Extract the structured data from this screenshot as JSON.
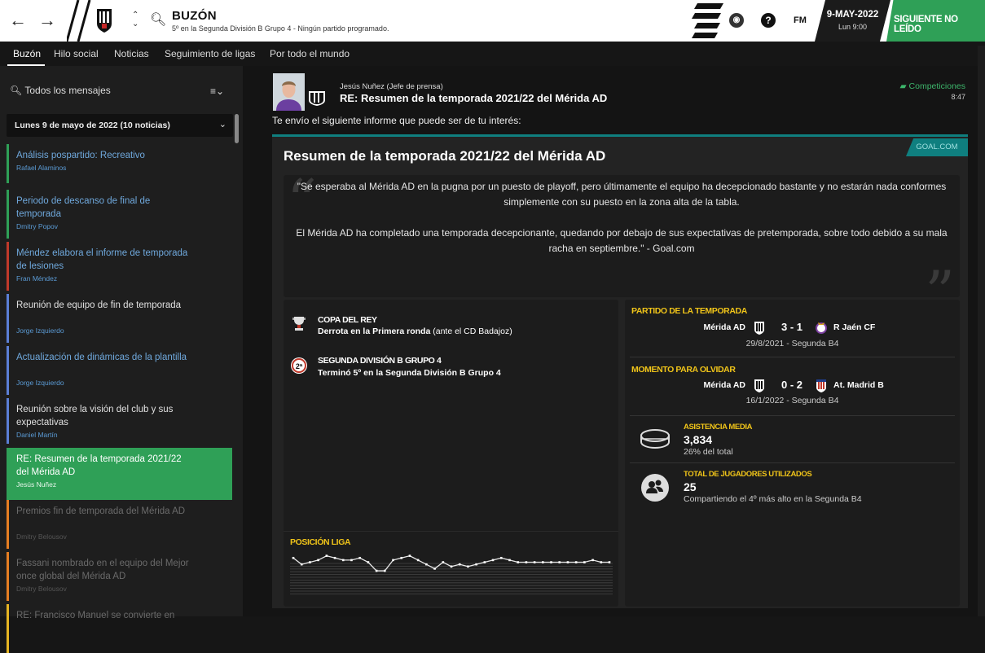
{
  "topbar": {
    "back_icon": "arrow-left-icon",
    "forward_icon": "arrow-right-icon",
    "title": "BUZÓN",
    "subtitle": "5º en la Segunda División B Grupo 4 - Ningún partido programado.",
    "fm_label": "FM",
    "help_label": "?",
    "date": "9-MAY-2022",
    "day": "Lun 9:00",
    "next_button": "SIGUIENTE NO LEÍDO",
    "colors": {
      "accent": "#2fa057",
      "teal": "#0f7f7f",
      "yellow": "#f0c419"
    }
  },
  "tabs": [
    "Buzón",
    "Hilo social",
    "Noticias",
    "Seguimiento de ligas",
    "Por todo el mundo"
  ],
  "sidebar": {
    "filter": "Todos los mensajes",
    "day_header": "Lunes 9 de mayo de 2022 (10 noticias)",
    "messages": [
      {
        "title": "Análisis pospartido: Recreativo",
        "sender": "Rafael Alaminos",
        "color": "#2fa057",
        "text_color": "#6fa8dc"
      },
      {
        "title": "Periodo de descanso de final de temporada",
        "sender": "Dmitry Popov",
        "color": "#2fa057",
        "text_color": "#6fa8dc"
      },
      {
        "title": "Méndez elabora el informe de temporada de lesiones",
        "sender": "Fran Méndez",
        "color": "#c0392b",
        "text_color": "#6fa8dc"
      },
      {
        "title": "Reunión de equipo de fin de temporada",
        "sender": "Jorge Izquierdo",
        "color": "#5b7fd6",
        "text_color": "#e0e0e0"
      },
      {
        "title": "Actualización de dinámicas de la plantilla",
        "sender": "Jorge Izquierdo",
        "color": "#5b7fd6",
        "text_color": "#6fa8dc"
      },
      {
        "title": "Reunión sobre la visión del club y sus expectativas",
        "sender": "Daniel Martín",
        "color": "#5b7fd6",
        "text_color": "#e0e0e0"
      },
      {
        "title": "RE: Resumen de la temporada 2021/22 del Mérida AD",
        "sender": "Jesús Nuñez",
        "color": "#2fa057",
        "text_color": "#ffffff"
      },
      {
        "title": "Premios fin de temporada del Mérida AD",
        "sender": "Dmitry Belousov",
        "color": "#e67e22",
        "text_color": "#6a6a6a"
      },
      {
        "title": "Fassani nombrado en el equipo del Mejor once global del Mérida AD",
        "sender": "Dmitry Belousov",
        "color": "#e67e22",
        "text_color": "#6a6a6a"
      },
      {
        "title": "RE: Francisco Manuel se convierte en",
        "sender": "",
        "color": "#e6b422",
        "text_color": "#6a6a6a"
      }
    ]
  },
  "message": {
    "sender": "Jesús Nuñez  (Jefe de prensa)",
    "subject": "RE: Resumen de la temporada 2021/22 del Mérida AD",
    "category": "Competiciones",
    "time": "8:47",
    "intro": "Te envío el siguiente informe que puede ser de tu interés:",
    "source": "GOAL.COM",
    "article_title": "Resumen de la temporada 2021/22 del Mérida AD",
    "quote_p1": "\"Se esperaba al Mérida AD en la pugna por un puesto de playoff, pero últimamente el equipo ha decepcionado bastante y no estarán nada conformes simplemente con su puesto en la zona alta de la tabla.",
    "quote_p2": "El Mérida AD ha completado una temporada decepcionante, quedando por debajo de sus expectativas de pretemporada, sobre todo debido a su mala racha en septiembre.\" - Goal.com"
  },
  "competitions": [
    {
      "name": "COPA DEL REY",
      "result_bold": "Derrota en la Primera ronda",
      "result_rest": " (ante el CD Badajoz)",
      "icon": "trophy-icon"
    },
    {
      "name": "SEGUNDA DIVISIÓN B GRUPO 4",
      "result_bold": "Terminó 5º en la Segunda División B Grupo 4",
      "result_rest": "",
      "icon": "league-badge-icon"
    }
  ],
  "league_position": {
    "label": "POSICIÓN LIGA"
  },
  "chart_data": {
    "type": "line",
    "title": "POSICIÓN LIGA",
    "series": [
      {
        "values": [
          3,
          6,
          5,
          4,
          2,
          3,
          4,
          4,
          3,
          5,
          9,
          9,
          4,
          3,
          2,
          4,
          6,
          8,
          5,
          7,
          6,
          7,
          6,
          5,
          4,
          3,
          4,
          5,
          5,
          5,
          5,
          5,
          5,
          5,
          5,
          5,
          4,
          5,
          5
        ]
      }
    ],
    "ylim": [
      1,
      20
    ],
    "inverted": true,
    "grid": true
  },
  "best_match": {
    "label": "PARTIDO DE LA TEMPORADA",
    "home": "Mérida AD",
    "score": "3 - 1",
    "away": "R Jaén CF",
    "date": "29/8/2021  -  Segunda B4"
  },
  "worst_match": {
    "label": "MOMENTO PARA OLVIDAR",
    "home": "Mérida AD",
    "score": "0 - 2",
    "away": "At. Madrid B",
    "date": "16/1/2022  -  Segunda B4"
  },
  "attendance": {
    "label": "ASISTENCIA MEDIA",
    "value": "3,834",
    "sub": "26% del total"
  },
  "players": {
    "label": "TOTAL DE JUGADORES UTILIZADOS",
    "value": "25",
    "sub": "Compartiendo el 4º más alto en la Segunda B4"
  }
}
